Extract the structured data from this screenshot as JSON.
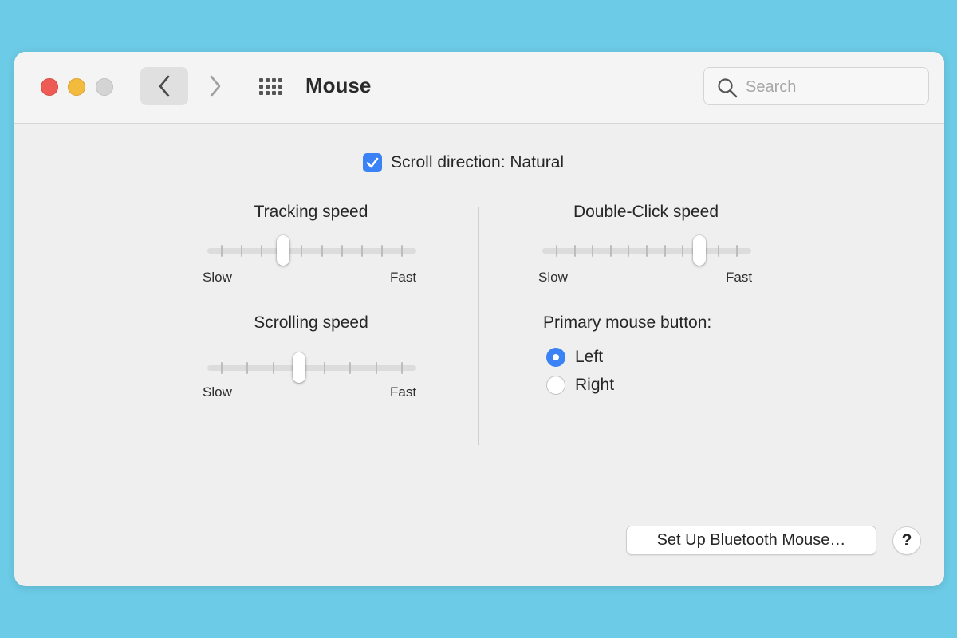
{
  "window": {
    "title": "Mouse",
    "search": {
      "placeholder": "Search",
      "value": ""
    }
  },
  "scroll_direction": {
    "label": "Scroll direction: Natural",
    "checked": true
  },
  "tracking_speed": {
    "label": "Tracking speed",
    "min_label": "Slow",
    "max_label": "Fast",
    "ticks": 10,
    "value_fraction": 0.34
  },
  "scrolling_speed": {
    "label": "Scrolling speed",
    "min_label": "Slow",
    "max_label": "Fast",
    "ticks": 8,
    "value_fraction": 0.43
  },
  "double_click_speed": {
    "label": "Double-Click speed",
    "min_label": "Slow",
    "max_label": "Fast",
    "ticks": 11,
    "value_fraction": 0.79
  },
  "primary_button": {
    "label": "Primary mouse button:",
    "options": [
      {
        "label": "Left",
        "selected": true
      },
      {
        "label": "Right",
        "selected": false
      }
    ]
  },
  "buttons": {
    "bluetooth": "Set Up Bluetooth Mouse…",
    "help": "?"
  },
  "colors": {
    "accent": "#3b82f6",
    "background": "#6ccbe6",
    "close": "#ee5b55",
    "minimize": "#f3bb3e"
  },
  "icons": [
    "back-chevron-icon",
    "forward-chevron-icon",
    "show-all-grid-icon",
    "search-icon",
    "checkmark-icon"
  ]
}
